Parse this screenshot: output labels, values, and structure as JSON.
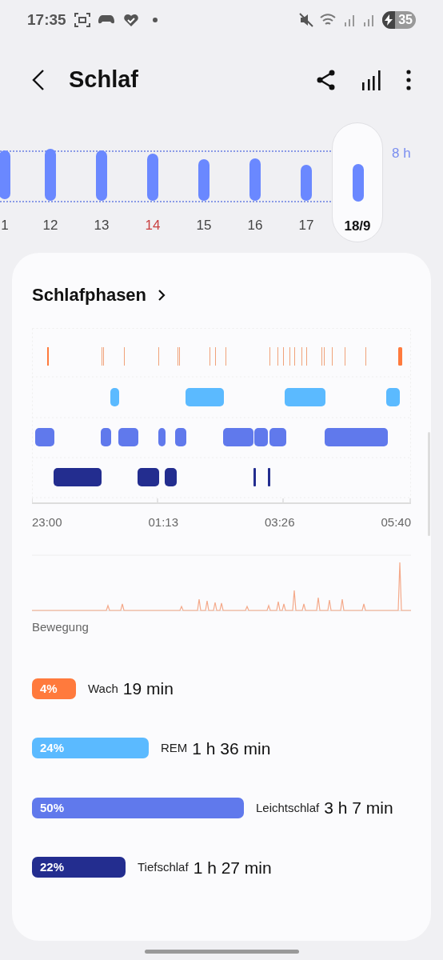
{
  "status_bar": {
    "time": "17:35",
    "battery": "35"
  },
  "header": {
    "title": "Schlaf"
  },
  "week": {
    "reference": "8 h",
    "days": [
      {
        "label": "1",
        "selected": false,
        "holiday": false
      },
      {
        "label": "12",
        "selected": false,
        "holiday": false
      },
      {
        "label": "13",
        "selected": false,
        "holiday": false
      },
      {
        "label": "14",
        "selected": false,
        "holiday": true
      },
      {
        "label": "15",
        "selected": false,
        "holiday": false
      },
      {
        "label": "16",
        "selected": false,
        "holiday": false
      },
      {
        "label": "17",
        "selected": false,
        "holiday": false
      },
      {
        "label": "18/9",
        "selected": true,
        "holiday": false
      }
    ]
  },
  "card": {
    "title": "Schlafphasen",
    "time_labels": [
      "23:00",
      "01:13",
      "03:26",
      "05:40"
    ],
    "movement_label": "Bewegung",
    "stages": [
      {
        "percent": "4%",
        "name": "Wach",
        "duration": "19 min",
        "color": "#ff7a3d"
      },
      {
        "percent": "24%",
        "name": "REM",
        "duration": "1 h 36 min",
        "color": "#5bbaff"
      },
      {
        "percent": "50%",
        "name": "Leichtschlaf",
        "duration": "3 h 7 min",
        "color": "#6079ec"
      },
      {
        "percent": "22%",
        "name": "Tiefschlaf",
        "duration": "1 h 27 min",
        "color": "#232d8f"
      }
    ]
  }
}
